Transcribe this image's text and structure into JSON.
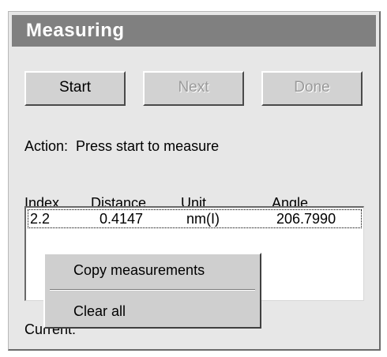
{
  "panel": {
    "title": "Measuring"
  },
  "buttons": {
    "start": "Start",
    "next": "Next",
    "done": "Done"
  },
  "action": {
    "label": "Action:",
    "text": "Press start to measure"
  },
  "table": {
    "headers": [
      "Index",
      "Distance",
      "Unit",
      "Angle"
    ],
    "rows": [
      [
        "2.2",
        "0.4147",
        "nm(I)",
        "206.7990"
      ]
    ]
  },
  "status": {
    "current_label": "Current:"
  },
  "context_menu": {
    "items": [
      "Copy measurements",
      "Clear all"
    ]
  }
}
